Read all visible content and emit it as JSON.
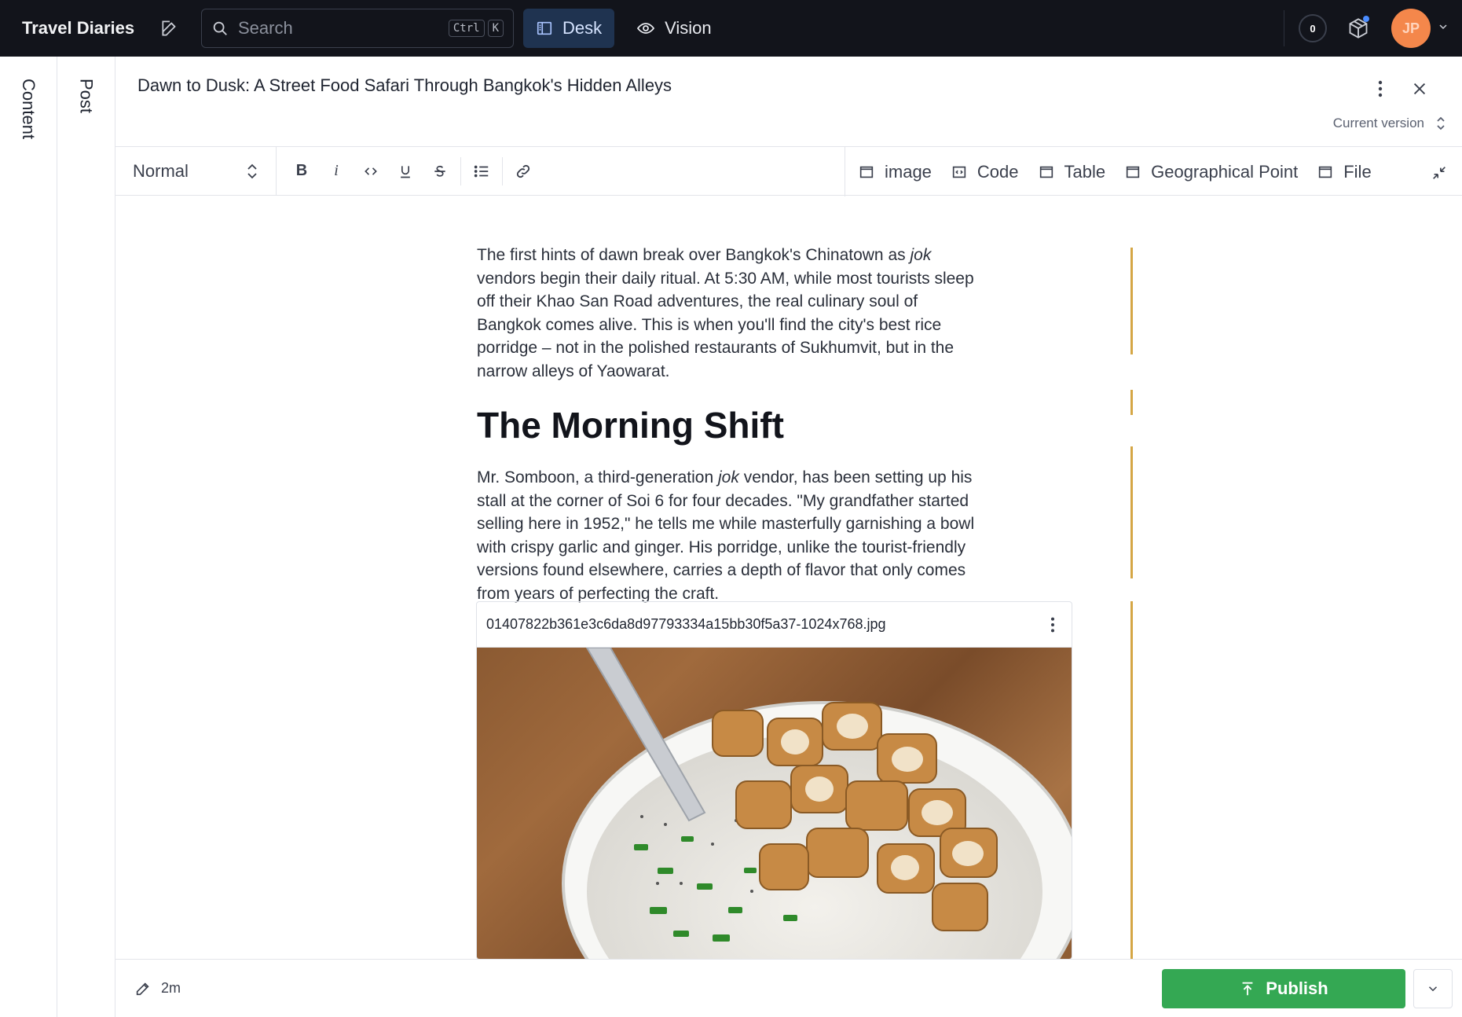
{
  "topbar": {
    "brand": "Travel Diaries",
    "search_placeholder": "Search",
    "kbd_ctrl": "Ctrl",
    "kbd_k": "K",
    "nav": [
      {
        "label": "Desk",
        "active": true
      },
      {
        "label": "Vision",
        "active": false
      }
    ],
    "notification_count": "0",
    "avatar_initials": "JP"
  },
  "rails": {
    "content_label": "Content",
    "post_label": "Post"
  },
  "document": {
    "title": "Dawn to Dusk: A Street Food Safari Through Bangkok's Hidden Alleys",
    "version_label": "Current version"
  },
  "toolbar": {
    "style_value": "Normal",
    "inserts": [
      "image",
      "Code",
      "Table",
      "Geographical Point",
      "File"
    ]
  },
  "body": {
    "p1_a": "The first hints of dawn break over Bangkok's Chinatown as ",
    "p1_em": "jok",
    "p1_b": " vendors begin their daily ritual. At 5:30 AM, while most tourists sleep off their Khao San Road adventures, the real culinary soul of Bangkok comes alive. This is when you'll find the city's best rice porridge – not in the polished restaurants of Sukhumvit, but in the narrow alleys of Yaowarat.",
    "heading": "The Morning Shift",
    "p2_a": "Mr. Somboon, a third-generation ",
    "p2_em": "jok",
    "p2_b": " vendor, has been setting up his stall at the corner of Soi 6 for four decades. \"My grandfather started selling here in 1952,\" he tells me while masterfully garnishing a bowl with crispy garlic and ginger. His porridge, unlike the tourist-friendly versions found elsewhere, carries a depth of flavor that only comes from years of perfecting the craft.",
    "image_filename": "01407822b361e3c6da8d97793334a15bb30f5a37-1024x768.jpg"
  },
  "footer": {
    "edited_ago": "2m",
    "publish_label": "Publish"
  },
  "colors": {
    "topbar_bg": "#12141b",
    "desk_active_bg": "#1f3350",
    "publish_green": "#34a853",
    "gutter_gold": "#d5a645",
    "avatar_orange": "#f4874b"
  }
}
